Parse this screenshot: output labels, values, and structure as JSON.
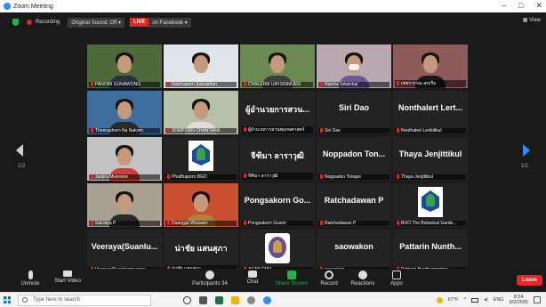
{
  "window": {
    "title": "Zoom Meeting",
    "controls": [
      "–",
      "□",
      "✕"
    ]
  },
  "topbar": {
    "recording_label": "Recording",
    "sound_option": "Original Sound: Off",
    "live_badge": "LIVE",
    "live_target": "on Facebook",
    "view_label": "View"
  },
  "pagination": {
    "left": "1/2",
    "right": "1/2"
  },
  "tiles": [
    {
      "kind": "video",
      "name": "PANOMI GUNAWONG",
      "active": true,
      "shirt": "#2a3140",
      "bg": "#4d6b3a"
    },
    {
      "kind": "video",
      "name": "Ratchaporn Suksathan",
      "shirt": "#e8e8e8",
      "bg": "#dfe5ea"
    },
    {
      "kind": "video",
      "name": "CHALERM UAYSRIMUEN",
      "shirt": "#3b3f3a",
      "bg": "#6a8a52"
    },
    {
      "kind": "video",
      "name": "Natcha Sriwichai",
      "shirt": "#6a5a9a",
      "bg": "#b8a9b0",
      "mask": true
    },
    {
      "kind": "video",
      "name": "เพชรวรรณ สุขเรือ",
      "shirt": "#1a1a1a",
      "bg": "#8e5a5a"
    },
    {
      "kind": "video",
      "name": "Theeraphorn Na Nakorn",
      "shirt": "#2b2b2b",
      "bg": "#3d6e9e"
    },
    {
      "kind": "video",
      "name": "SOMPORN CHANTARA",
      "shirt": "#e0dcd8",
      "bg": "#b7c0a8"
    },
    {
      "kind": "text",
      "big": "ผู้อำนวยการสวน...",
      "name": "ผู้อำนวยการสวนพฤกษศาสตร์"
    },
    {
      "kind": "text",
      "big": "Siri Dao",
      "name": "Siri Dao"
    },
    {
      "kind": "text",
      "big": "Nonthalert Lert...",
      "name": "Nonthalert Lertkitikul"
    },
    {
      "kind": "video",
      "name": "Janjira Muenrew",
      "shirt": "#d23c3c",
      "bg": "#c2c2c2"
    },
    {
      "kind": "logo",
      "name": "Phutthaporn BGO"
    },
    {
      "kind": "text",
      "big": "จีฑิมา ลาราวุฒิ",
      "name": "จีฑิมา ลาราวุฒิ"
    },
    {
      "kind": "text",
      "big": "Noppadon Ton...",
      "name": "Noppadon Tonapo"
    },
    {
      "kind": "text",
      "big": "Thaya Jenjittikul",
      "name": "Thaya Jenjittikul"
    },
    {
      "kind": "video",
      "name": "Sairatpa P",
      "shirt": "#2b2b2b",
      "bg": "#a8a090"
    },
    {
      "kind": "video",
      "name": "Duangjai Wussam",
      "shirt": "#b08040",
      "bg": "#c85030"
    },
    {
      "kind": "text",
      "big": "Pongsakorn Go...",
      "name": "Pongsakorn Gosrin"
    },
    {
      "kind": "text",
      "big": "Ratchadawan P",
      "name": "Ratchadawan P"
    },
    {
      "kind": "logo",
      "name": "BGO The Botanical Garde..."
    },
    {
      "kind": "text",
      "big": "Veeraya(Suanlu...",
      "name": "Veeraya(Suanluang rama..."
    },
    {
      "kind": "text",
      "big": "น่าชัย แสนสุภา",
      "name": "น่าชัย แสนสุภา"
    },
    {
      "kind": "logo-round",
      "name": "ACAP CMU"
    },
    {
      "kind": "text",
      "big": "saowakon",
      "name": "saowakon"
    },
    {
      "kind": "text",
      "big": "Pattarin Nunth...",
      "name": "Pattarin Nunthamontree"
    }
  ],
  "controls": {
    "unmute": "Unmute",
    "start_video": "Start Video",
    "participants": "Participants",
    "participants_count": "34",
    "chat": "Chat",
    "share_screen": "Share Screen",
    "record": "Record",
    "reactions": "Reactions",
    "apps": "Apps",
    "leave": "Leave"
  },
  "taskbar": {
    "search_placeholder": "Type here to search",
    "weather": "67°F",
    "language": "ENG",
    "time": "8:54",
    "date": "9/2/2565"
  },
  "colors": {
    "accent_blue": "#2d8cff",
    "live_red": "#e02828",
    "share_green": "#22b24c",
    "active_speaker": "#d4e64a"
  }
}
